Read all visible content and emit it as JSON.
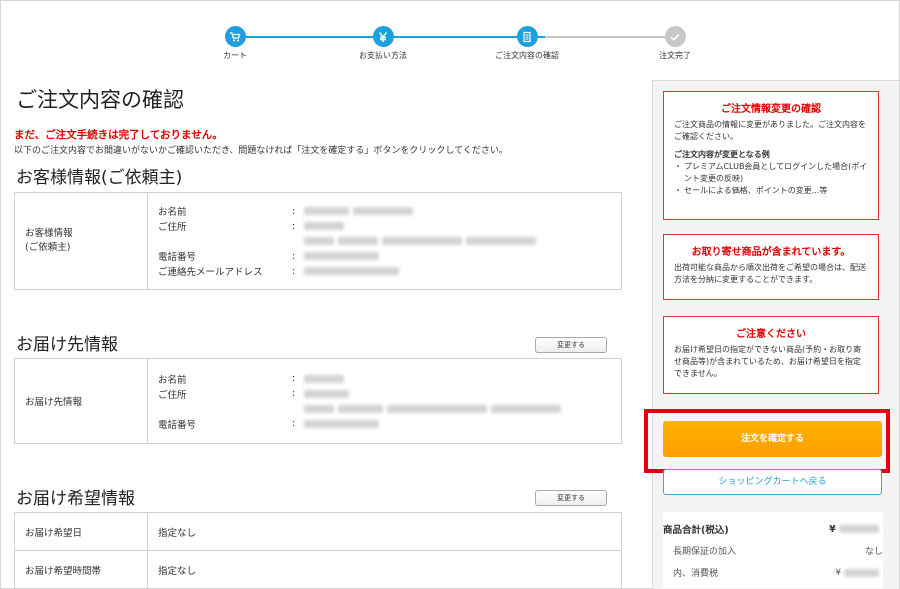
{
  "stepper": {
    "steps": [
      {
        "label": "カート",
        "icon": "cart-icon",
        "state": "done"
      },
      {
        "label": "お支払い方法",
        "icon": "yen-icon",
        "state": "done"
      },
      {
        "label": "ご注文内容の確認",
        "icon": "document-icon",
        "state": "current"
      },
      {
        "label": "注文完了",
        "icon": "check-icon",
        "state": "pending"
      }
    ],
    "colors": {
      "active": "#1ea0de",
      "inactive": "#c7c7c7"
    }
  },
  "page": {
    "title": "ご注文内容の確認",
    "warning": "まだ、ご注文手続きは完了しておりません。",
    "note": "以下のご注文内容でお間違いがないかご確認いただき、問題なければ「注文を確定する」ボタンをクリックしてください。"
  },
  "customer": {
    "section_title": "お客様情報(ご依頼主)",
    "head_label": "お客様情報\n(ご依頼主)",
    "fields": {
      "name": "お名前",
      "address": "ご住所",
      "phone": "電話番号",
      "email": "ご連絡先メールアドレス"
    },
    "separator": ":"
  },
  "delivery": {
    "section_title": "お届け先情報",
    "change_label": "変更する",
    "head_label": "お届け先情報",
    "fields": {
      "name": "お名前",
      "address": "ご住所",
      "phone": "電話番号"
    },
    "separator": ":"
  },
  "preference": {
    "section_title": "お届け希望情報",
    "change_label": "変更する",
    "rows": [
      {
        "label": "お届け希望日",
        "value": "指定なし"
      },
      {
        "label": "お届け希望時間帯",
        "value": "指定なし"
      }
    ]
  },
  "sidebar": {
    "alert1": {
      "title": "ご注文情報変更の確認",
      "body": "ご注文商品の情報に変更がありました。ご注文内容をご確認ください。",
      "subtitle": "ご注文内容が変更となる例",
      "items": [
        "プレミアムCLUB会員としてログインした場合(ポイント変更の反映)",
        "セールによる価格、ポイントの変更...等"
      ]
    },
    "alert2": {
      "title": "お取り寄せ商品が含まれています。",
      "body": "出荷可能な商品から順次出荷をご希望の場合は、配送方法を分納に変更することができます。"
    },
    "alert3": {
      "title": "ご注意ください",
      "body": "お届け希望日の指定ができない商品(予約・お取り寄せ商品等)が含まれているため、お届け希望日を指定できません。"
    },
    "confirm_label": "注文を確定する",
    "back_label": "ショッピングカートへ戻る",
    "summary": {
      "total_label": "商品合計(税込)",
      "currency": "¥",
      "warranty_label": "長期保証の加入",
      "warranty_value": "なし",
      "tax_label": "内、消費税"
    }
  }
}
